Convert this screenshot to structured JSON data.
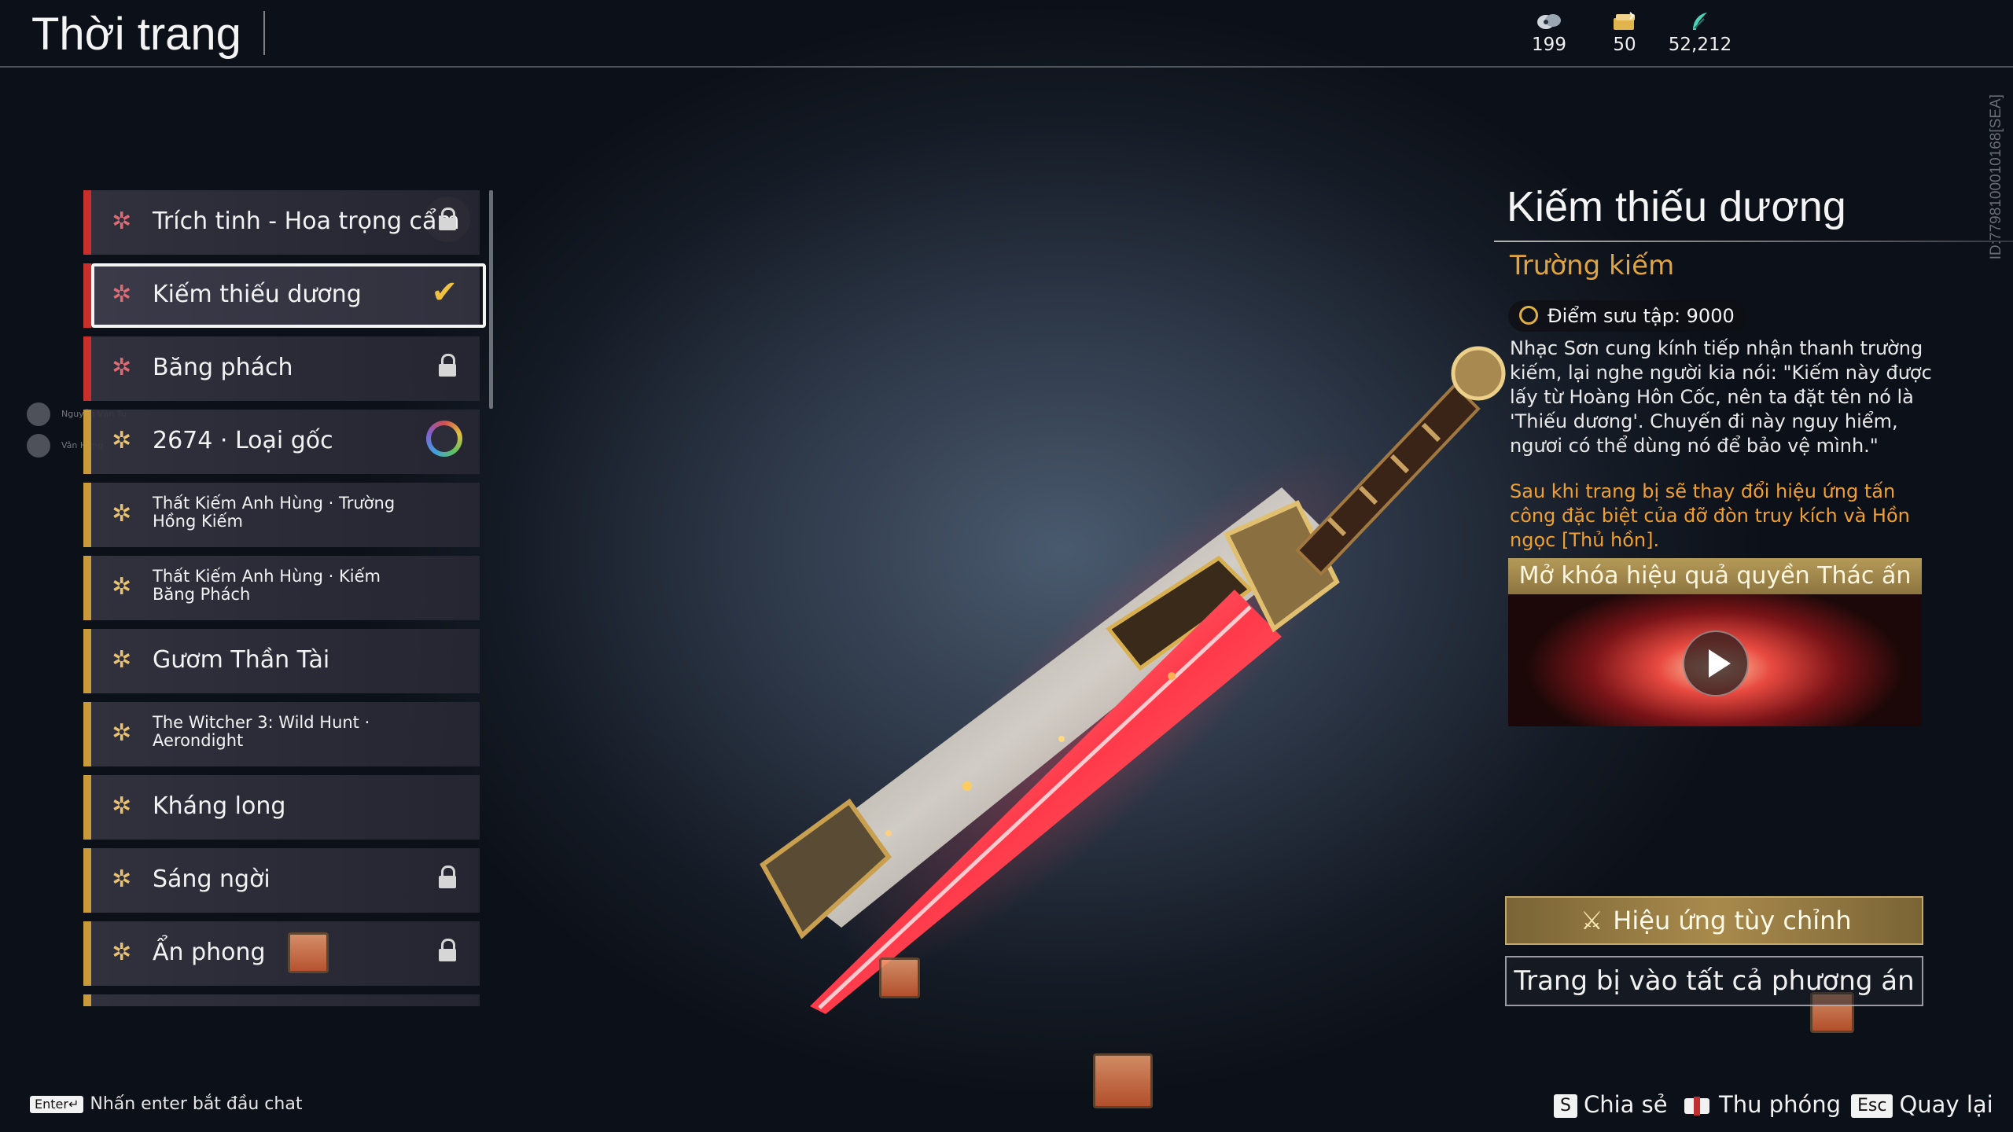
{
  "header": {
    "title": "Thời trang",
    "currencies": [
      {
        "icon": "jade-icon",
        "value": "199"
      },
      {
        "icon": "ticket-icon",
        "value": "50"
      },
      {
        "icon": "feather-icon",
        "value": "52,212"
      }
    ],
    "id_tag": "ID:7798100010168[SEA]"
  },
  "side_players": [
    {
      "name": "Nguyễn Văn Tú"
    },
    {
      "name": "Vân Hưng"
    }
  ],
  "skins": [
    {
      "label": "Trích tinh - Hoa trọng cẩm",
      "rarity": "red",
      "status": "locked"
    },
    {
      "label": "Kiếm thiếu dương",
      "rarity": "red",
      "status": "equipped",
      "selected": true
    },
    {
      "label": "Băng phách",
      "rarity": "red",
      "status": "locked"
    },
    {
      "label": "2674 · Loại gốc",
      "rarity": "gold",
      "status": "dye"
    },
    {
      "label": "Thất Kiếm Anh Hùng · Trường Hồng Kiếm",
      "rarity": "gold",
      "status": ""
    },
    {
      "label": "Thất Kiếm Anh Hùng · Kiếm Băng Phách",
      "rarity": "gold",
      "status": ""
    },
    {
      "label": "Gươm Thần Tài",
      "rarity": "gold",
      "status": ""
    },
    {
      "label": "The Witcher 3: Wild Hunt · Aerondight",
      "rarity": "gold",
      "status": ""
    },
    {
      "label": "Kháng long",
      "rarity": "gold",
      "status": ""
    },
    {
      "label": "Sáng ngời",
      "rarity": "gold",
      "status": "locked"
    },
    {
      "label": "Ẩn phong",
      "rarity": "gold",
      "status": "locked"
    }
  ],
  "detail": {
    "name": "Kiếm thiếu dương",
    "type": "Trường kiếm",
    "collection_score": "Điểm sưu tập: 9000",
    "lore": "Nhạc Sơn cung kính tiếp nhận thanh trường kiếm, lại nghe người kia nói: \"Kiếm này được lấy từ Hoàng Hôn Cốc, nên ta đặt tên nó là 'Thiếu dương'. Chuyến đi này nguy hiểm, ngươi có thể dùng nó để bảo vệ mình.\"",
    "effect_note": "Sau khi trang bị sẽ thay đổi hiệu ứng tấn công đặc biệt của đỡ đòn truy kích và Hồn ngọc [Thủ hồn].",
    "video_title": "Mở khóa hiệu quả quyền Thác ấn",
    "custom_effect_label": "Hiệu ứng tùy chỉnh",
    "equip_all_label": "Trang bị vào tất cả phương án"
  },
  "footer": {
    "chat_key": "Enter↵",
    "chat_hint": "Nhấn enter bắt đầu chat",
    "actions": [
      {
        "key": "S",
        "label": "Chia sẻ"
      },
      {
        "key": "",
        "label": "Thu phóng"
      },
      {
        "key": "Esc",
        "label": "Quay lại"
      }
    ]
  },
  "colors": {
    "accent_red": "#c9302c",
    "accent_gold": "#c89a3a",
    "type_text": "#e0a440",
    "note_text": "#f0a030"
  }
}
